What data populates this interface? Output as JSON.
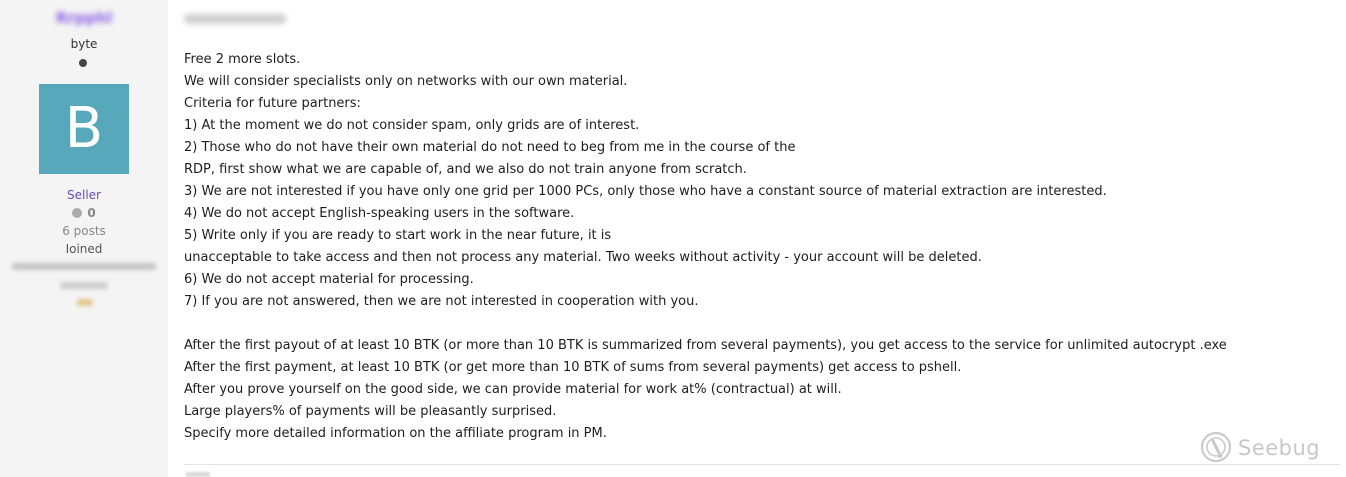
{
  "user": {
    "username": "Rrpphl",
    "rank": "byte",
    "avatar_letter": "B",
    "avatar_color": "#57a8bb",
    "group": "Seller",
    "reputation": "0",
    "posts": "6 posts",
    "joined_label": "Joined"
  },
  "post": {
    "date": "Posted April 19",
    "lines": [
      "Free 2 more slots.",
      "We will consider specialists only on networks with our own material.",
      "Criteria for future partners:",
      "1) At the moment we do not consider spam, only grids are of interest.",
      "2) Those who do not have their own material do not need to beg from me in the course of the",
      "RDP, first show what we are capable of, and we also do not train anyone from scratch.",
      "3) We are not interested if you have only one grid per 1000 PCs, only those who have a constant source of material extraction are interested.",
      "4) We do not accept English-speaking users in the software.",
      "5) Write only if you are ready to start work in the near future, it is",
      "unacceptable to take access and then not process any material. Two weeks without activity - your account will be deleted.",
      "6) We do not accept material for processing.",
      "7) If you are not answered, then we are not interested in cooperation with you.",
      "",
      "After the first payout of at least 10 BTK (or more than 10 BTK is summarized from several payments), you get access to the service for unlimited autocrypt .exe",
      "After the first payment, at least 10 BTK (or get more than 10 BTK of sums from several payments) get access to pshell.",
      "After you prove yourself on the good side, we can provide material for work at% (contractual) at will.",
      "Large players% of payments will be pleasantly surprised.",
      "Specify more detailed information on the affiliate program in PM."
    ]
  },
  "watermark": {
    "text": "Seebug",
    "icon": "seebug-logo-icon"
  }
}
